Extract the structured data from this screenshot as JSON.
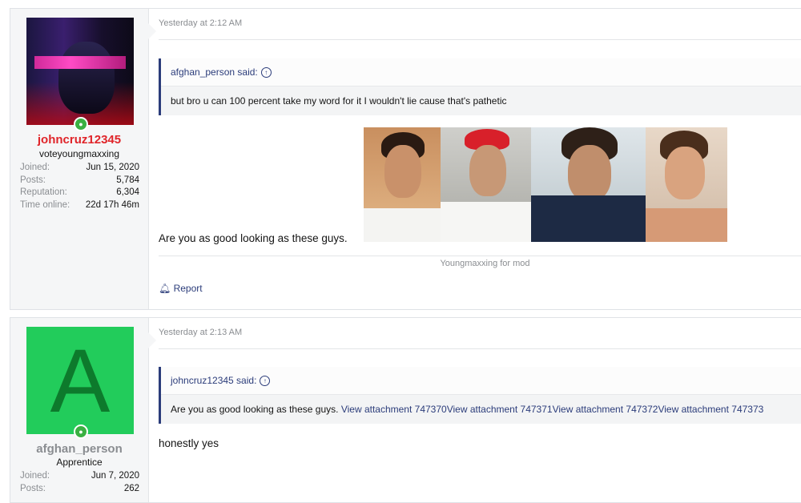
{
  "posts": [
    {
      "username": "johncruz12345",
      "username_color": "#e0252a",
      "user_title": "voteyoungmaxxing",
      "stats": [
        {
          "label": "Joined:",
          "value": "Jun 15, 2020"
        },
        {
          "label": "Posts:",
          "value": "5,784"
        },
        {
          "label": "Reputation:",
          "value": "6,304"
        },
        {
          "label": "Time online:",
          "value": "22d 17h 46m"
        }
      ],
      "timestamp": "Yesterday at 2:12 AM",
      "quote": {
        "author_label": "afghan_person said:",
        "text": "but bro u can 100 percent take my word for it I wouldn't lie cause that's pathetic"
      },
      "message": "Are you as good looking as these guys.",
      "signature": "Youngmaxxing for mod",
      "report_label": "Report"
    },
    {
      "username": "afghan_person",
      "username_color": "#8a8d91",
      "avatar_letter": "A",
      "user_title": "Apprentice",
      "stats": [
        {
          "label": "Joined:",
          "value": "Jun 7, 2020"
        },
        {
          "label": "Posts:",
          "value": "262"
        }
      ],
      "timestamp": "Yesterday at 2:13 AM",
      "quote": {
        "author_label": "johncruz12345 said:",
        "text": "Are you as good looking as these guys. ",
        "attachments": [
          "View attachment 747370",
          "View attachment 747371",
          "View attachment 747372",
          "View attachment 747373"
        ]
      },
      "message": "honestly yes"
    }
  ],
  "icons": {
    "online": "person-online-icon",
    "quote_jump": "arrow-up-circle-icon",
    "report": "bell-icon"
  }
}
